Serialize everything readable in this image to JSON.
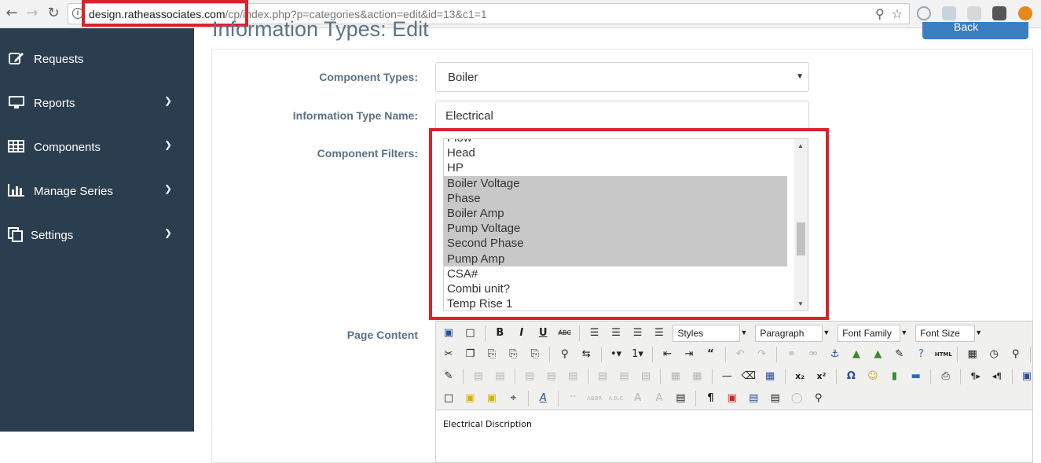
{
  "browser": {
    "url_domain": "design.ratheassociates.com",
    "url_path": "/cp/index.php?p=categories&action=edit&id=13&c1=1"
  },
  "sidebar": {
    "items": [
      {
        "label": "Requests",
        "icon": "edit-icon",
        "has_chevron": false
      },
      {
        "label": "Reports",
        "icon": "monitor-icon",
        "has_chevron": true
      },
      {
        "label": "Components",
        "icon": "table-icon",
        "has_chevron": true
      },
      {
        "label": "Manage Series",
        "icon": "bar-chart-icon",
        "has_chevron": true
      },
      {
        "label": "Settings",
        "icon": "copy-icon",
        "has_chevron": true
      }
    ]
  },
  "main": {
    "title": "Information Types: Edit",
    "back_label": "Back",
    "form": {
      "component_types_label": "Component Types:",
      "component_types_value": "Boiler",
      "info_type_name_label": "Information Type Name:",
      "info_type_name_value": "Electrical",
      "component_filters_label": "Component Filters:",
      "filters": [
        {
          "label": "Flow",
          "selected": false
        },
        {
          "label": "Head",
          "selected": false
        },
        {
          "label": "HP",
          "selected": false
        },
        {
          "label": "Boiler Voltage",
          "selected": true
        },
        {
          "label": "Phase",
          "selected": true
        },
        {
          "label": "Boiler Amp",
          "selected": true
        },
        {
          "label": "Pump Voltage",
          "selected": true
        },
        {
          "label": "Second Phase",
          "selected": true
        },
        {
          "label": "Pump Amp",
          "selected": true
        },
        {
          "label": "CSA#",
          "selected": false
        },
        {
          "label": "Combi unit?",
          "selected": false
        },
        {
          "label": "Temp Rise 1",
          "selected": false
        }
      ],
      "page_content_label": "Page Content"
    },
    "editor": {
      "styles": "Styles",
      "paragraph": "Paragraph",
      "font_family": "Font Family",
      "font_size": "Font Size",
      "content": "Electrical Discription"
    }
  },
  "colors": {
    "sidebar_bg": "#2b3e50",
    "highlight_red": "#d9222a",
    "selected_option_bg": "#c8c8c8",
    "label_color": "#5b7284"
  }
}
